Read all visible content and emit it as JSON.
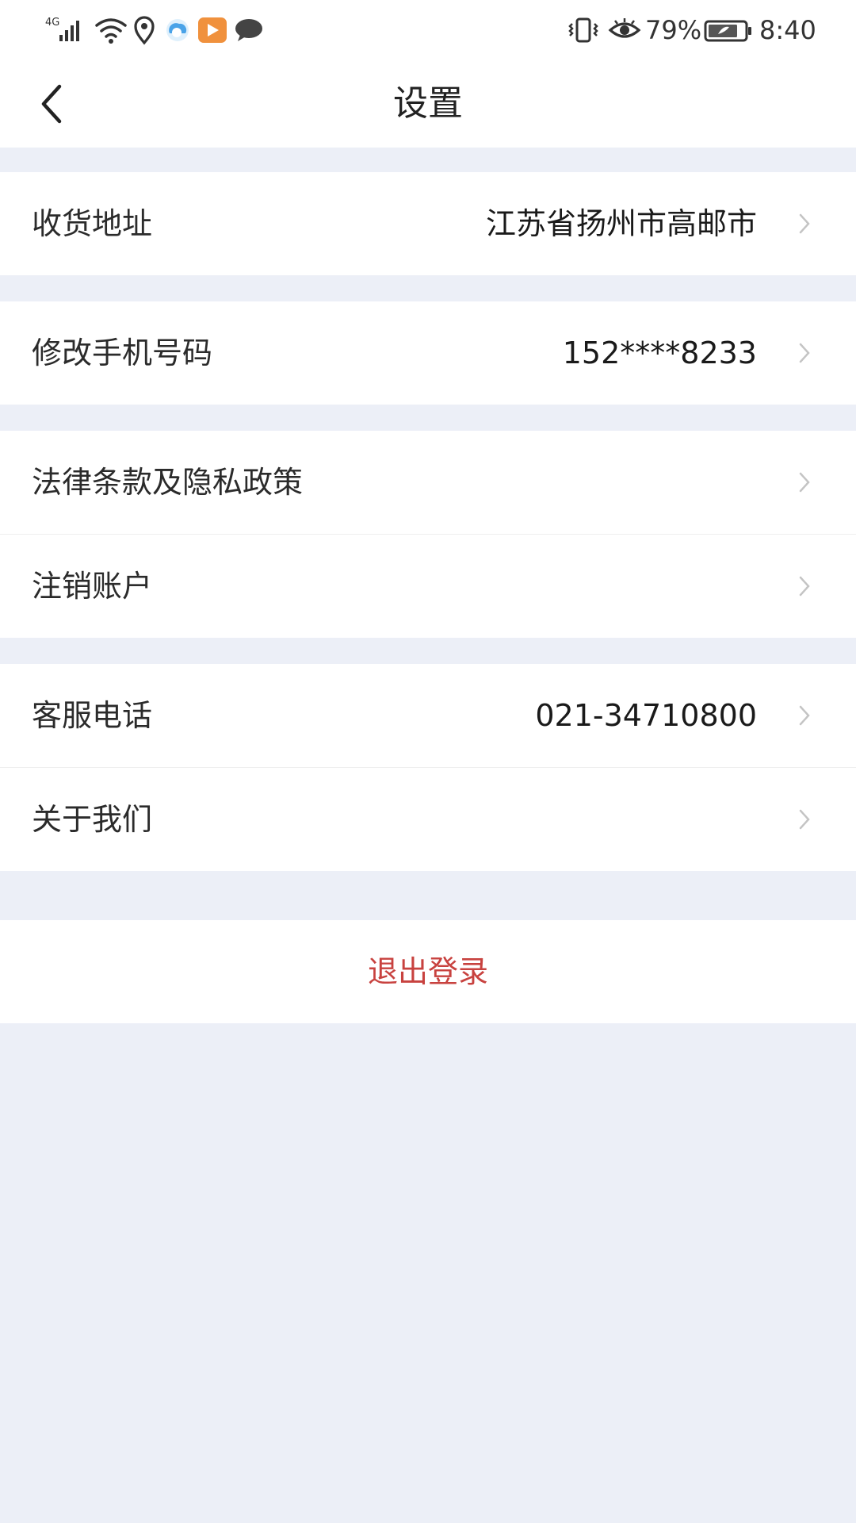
{
  "status_bar": {
    "network_label": "4G",
    "battery_percent": "79%",
    "time": "8:40",
    "icons": [
      "signal-icon",
      "wifi-icon",
      "location-icon",
      "weather-app-icon",
      "video-app-icon",
      "message-icon",
      "vibrate-icon",
      "eye-comfort-icon",
      "battery-icon"
    ],
    "accent_orange": "#f0913d",
    "accent_blue": "#4aa3e8"
  },
  "header": {
    "title": "设置",
    "back_icon": "chevron-left-icon"
  },
  "settings": {
    "address": {
      "label": "收货地址",
      "value": "江苏省扬州市高邮市"
    },
    "phone": {
      "label": "修改手机号码",
      "value": "152****8233"
    },
    "legal": {
      "label": "法律条款及隐私政策"
    },
    "cancel_account": {
      "label": "注销账户"
    },
    "service": {
      "label": "客服电话",
      "value": "021-34710800"
    },
    "about": {
      "label": "关于我们"
    }
  },
  "logout": {
    "label": "退出登录",
    "color": "#c8423f"
  },
  "colors": {
    "background": "#eceff7",
    "surface": "#ffffff",
    "chevron": "#c4c4c4"
  }
}
